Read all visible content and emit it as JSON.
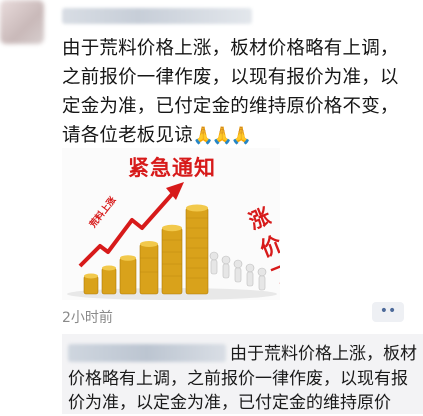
{
  "post": {
    "text": "由于荒料价格上涨，板材价格略有上调，之前报价一律作废，以现有报价为准，以定金为准，已付定金的维持原价格不变，请各位老板见谅",
    "emojis": [
      "🙏",
      "🙏",
      "🙏"
    ],
    "time": "2小时前",
    "more_label": "••"
  },
  "image": {
    "title": "紧急通知",
    "tag": "涨价了",
    "rise_label": "荒料上涨"
  },
  "comment": {
    "text": "由于荒料价格上涨，板材价格略有上调，之前报价一律作废，以现有报价为准，以定金为准，已付定金的维持原价"
  }
}
